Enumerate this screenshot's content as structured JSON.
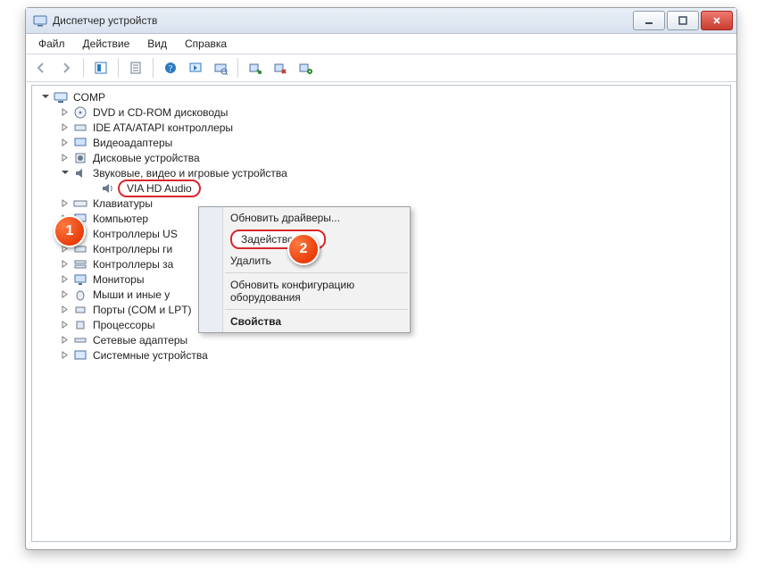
{
  "window": {
    "title": "Диспетчер устройств"
  },
  "menu": {
    "file": "Файл",
    "action": "Действие",
    "view": "Вид",
    "help": "Справка"
  },
  "tree": {
    "root": "COMP",
    "items": {
      "dvd": "DVD и CD-ROM дисководы",
      "ide": "IDE ATA/ATAPI контроллеры",
      "video": "Видеоадаптеры",
      "disk": "Дисковые устройства",
      "sound": "Звуковые, видео и игровые устройства",
      "via": "VIA HD Audio",
      "keyboards": "Клавиатуры",
      "computer": "Компьютер",
      "usb": "Контроллеры USB",
      "hid": "Контроллеры гибких дисков",
      "mem": "Контроллеры запоминающих устройств",
      "monitors": "Мониторы",
      "mice": "Мыши и иные указывающие устройства",
      "ports": "Порты (COM и LPT)",
      "cpu": "Процессоры",
      "net": "Сетевые адаптеры",
      "sys": "Системные устройства"
    },
    "items_truncated": {
      "usb": "Контроллеры US",
      "hid": "Контроллеры ги",
      "mem": "Контроллеры за",
      "mice": "Мыши и иные у"
    }
  },
  "context_menu": {
    "update_drivers": "Обновить драйверы...",
    "enable": "Задействовать",
    "delete": "Удалить",
    "scan": "Обновить конфигурацию оборудования",
    "properties": "Свойства"
  },
  "badges": {
    "one": "1",
    "two": "2"
  }
}
